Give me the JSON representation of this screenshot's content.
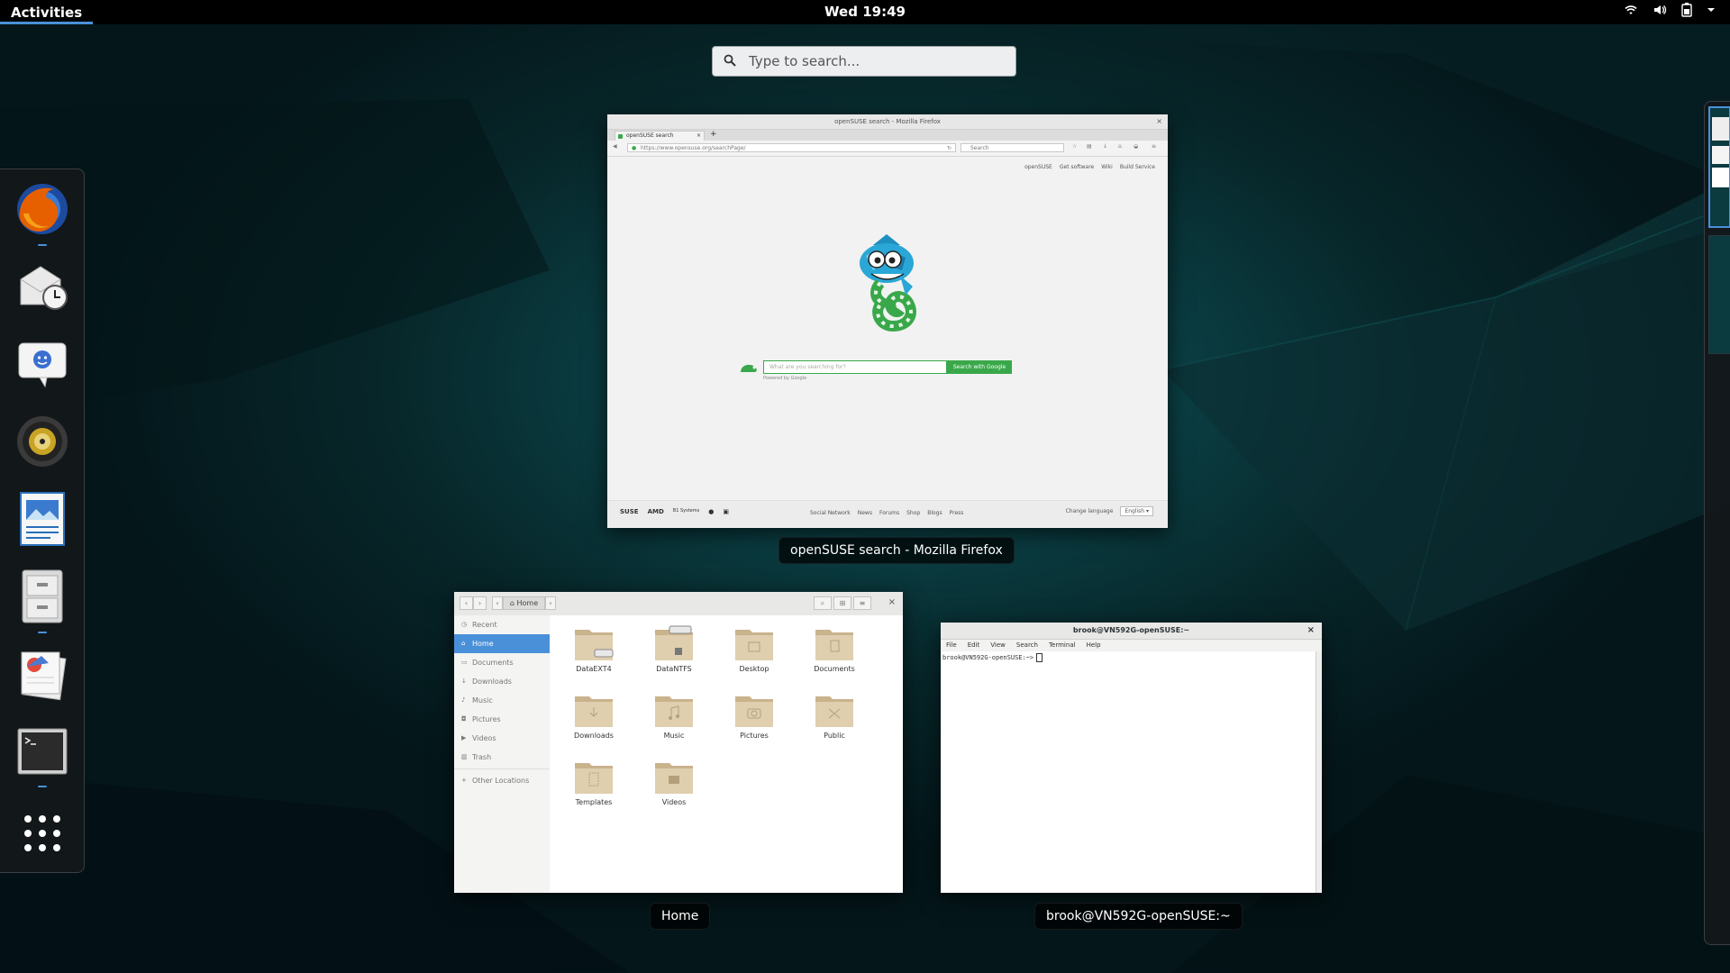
{
  "topbar": {
    "activities": "Activities",
    "clock": "Wed 19:49"
  },
  "search": {
    "placeholder": "Type to search..."
  },
  "dash": {
    "apps": [
      "firefox-icon",
      "evolution-icon",
      "empathy-icon",
      "rhythmbox-icon",
      "libreoffice-writer-icon",
      "files-icon",
      "shotwell-icon",
      "terminal-icon",
      "show-applications-icon"
    ]
  },
  "windows": {
    "firefox": {
      "caption": "openSUSE search - Mozilla Firefox",
      "title": "openSUSE search - Mozilla Firefox",
      "tab": "openSUSE search",
      "url": "https://www.opensuse.org/searchPage/",
      "search_placeholder": "Search",
      "top_links": [
        "openSUSE",
        "Get software",
        "Wiki",
        "Build Service"
      ],
      "query_placeholder": "What are you searching for?",
      "search_button": "Search with Google",
      "powered": "Powered by Google",
      "footer_brands": [
        "SUSE",
        "AMD",
        "B1 Systems"
      ],
      "footer_links": [
        "Social Network",
        "News",
        "Forums",
        "Shop",
        "Blogs",
        "Press"
      ],
      "change_language": "Change language",
      "language": "English"
    },
    "files": {
      "caption": "Home",
      "path": "Home",
      "sidebar": [
        "Recent",
        "Home",
        "Documents",
        "Downloads",
        "Music",
        "Pictures",
        "Videos",
        "Trash",
        "Other Locations"
      ],
      "folders": [
        "DataEXT4",
        "DataNTFS",
        "Desktop",
        "Documents",
        "Downloads",
        "Music",
        "Pictures",
        "Public",
        "Templates",
        "Videos"
      ]
    },
    "terminal": {
      "caption": "brook@VN592G-openSUSE:~",
      "title": "brook@VN592G-openSUSE:~",
      "menu": [
        "File",
        "Edit",
        "View",
        "Search",
        "Terminal",
        "Help"
      ],
      "prompt": "brook@VN592G-openSUSE:~>"
    }
  },
  "colors": {
    "accent": "#4a90d9",
    "opensuse_green": "#39a84a"
  }
}
